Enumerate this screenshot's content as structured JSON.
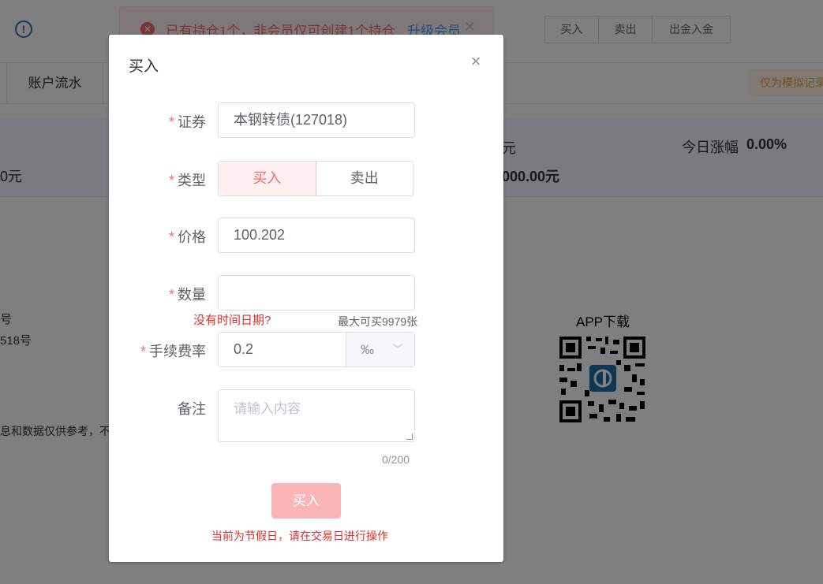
{
  "topbar": {
    "alert_text": "已有持仓1个，非会员仅可创建1个持仓",
    "alert_link": "升级会员",
    "buttons": [
      "买入",
      "卖出",
      "出金入金"
    ]
  },
  "tabs": {
    "flow_label": "账户流水",
    "sim_tag": "仅为模拟记录"
  },
  "stats": {
    "left_value": "0元",
    "mid_unit": "元",
    "mid_value": "000.00元",
    "today_label": "今日涨幅",
    "today_value": "0.00%"
  },
  "footer": {
    "line1": "号",
    "line2": "518号",
    "disclaimer": "息和数据仅供参考，不",
    "app_title": "APP下载"
  },
  "dialog": {
    "title": "买入",
    "required_mark": "*",
    "labels": {
      "security": "证券",
      "type": "类型",
      "price": "价格",
      "quantity": "数量",
      "fee": "手续费率",
      "note": "备注"
    },
    "security_value": "本钢转债(127018)",
    "type_options": [
      "买入",
      "卖出"
    ],
    "type_selected": "买入",
    "price_value": "100.202",
    "quantity_value": "",
    "no_date_hint": "没有时间日期?",
    "max_buy": "最大可买9979张",
    "fee_value": "0.2",
    "fee_unit": "‰",
    "note_placeholder": "请输入内容",
    "note_counter": "0/200",
    "submit_label": "买入",
    "holiday_notice": "当前为节假日，请在交易日进行操作"
  },
  "colors": {
    "danger": "#f56c6c",
    "overlay": "rgba(0,0,0,0.5)",
    "submit_disabled": "#fab6b6"
  }
}
